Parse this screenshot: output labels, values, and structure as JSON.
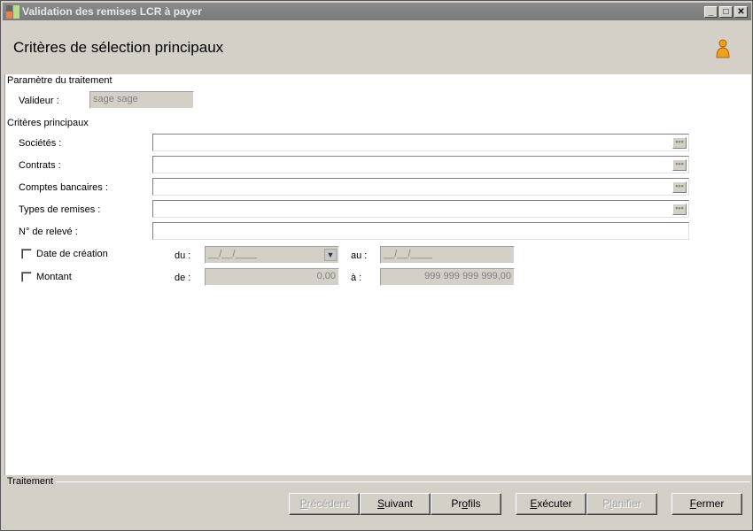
{
  "window": {
    "title": "Validation des remises LCR à payer",
    "minimize": "_",
    "maximize": "□",
    "close": "✕"
  },
  "header": {
    "title": "Critères de sélection principaux",
    "icon": "user-icon"
  },
  "param": {
    "group": "Paramètre du traitement",
    "validator_label": "Valideur :",
    "validator_value": "sage sage"
  },
  "criteria": {
    "group": "Critères principaux",
    "fields": [
      {
        "label": "Sociétés :",
        "value": ""
      },
      {
        "label": "Contrats :",
        "value": ""
      },
      {
        "label": "Comptes bancaires :",
        "value": ""
      },
      {
        "label": "Types de remises :",
        "value": ""
      },
      {
        "label": "N° de relevé :",
        "value": ""
      }
    ],
    "browse": "•••",
    "date": {
      "label": "Date de création",
      "from_label": "du :",
      "from_value": "__/__/____",
      "to_label": "au :",
      "to_value": "__/__/____",
      "checked": false
    },
    "amount": {
      "label": "Montant",
      "from_label": "de :",
      "from_value": "0,00",
      "to_label": "à :",
      "to_value": "999 999 999 999,00",
      "checked": false
    }
  },
  "footer": {
    "group": "Traitement",
    "buttons": [
      {
        "pre": "",
        "key": "P",
        "post": "récédent",
        "enabled": false
      },
      {
        "pre": "",
        "key": "S",
        "post": "uivant",
        "enabled": true
      },
      {
        "pre": "Pr",
        "key": "o",
        "post": "fils",
        "enabled": true
      },
      {
        "pre": "",
        "key": "E",
        "post": "xécuter",
        "enabled": true
      },
      {
        "pre": "P",
        "key": "l",
        "post": "anifier",
        "enabled": false
      },
      {
        "pre": "",
        "key": "F",
        "post": "ermer",
        "enabled": true
      }
    ]
  }
}
